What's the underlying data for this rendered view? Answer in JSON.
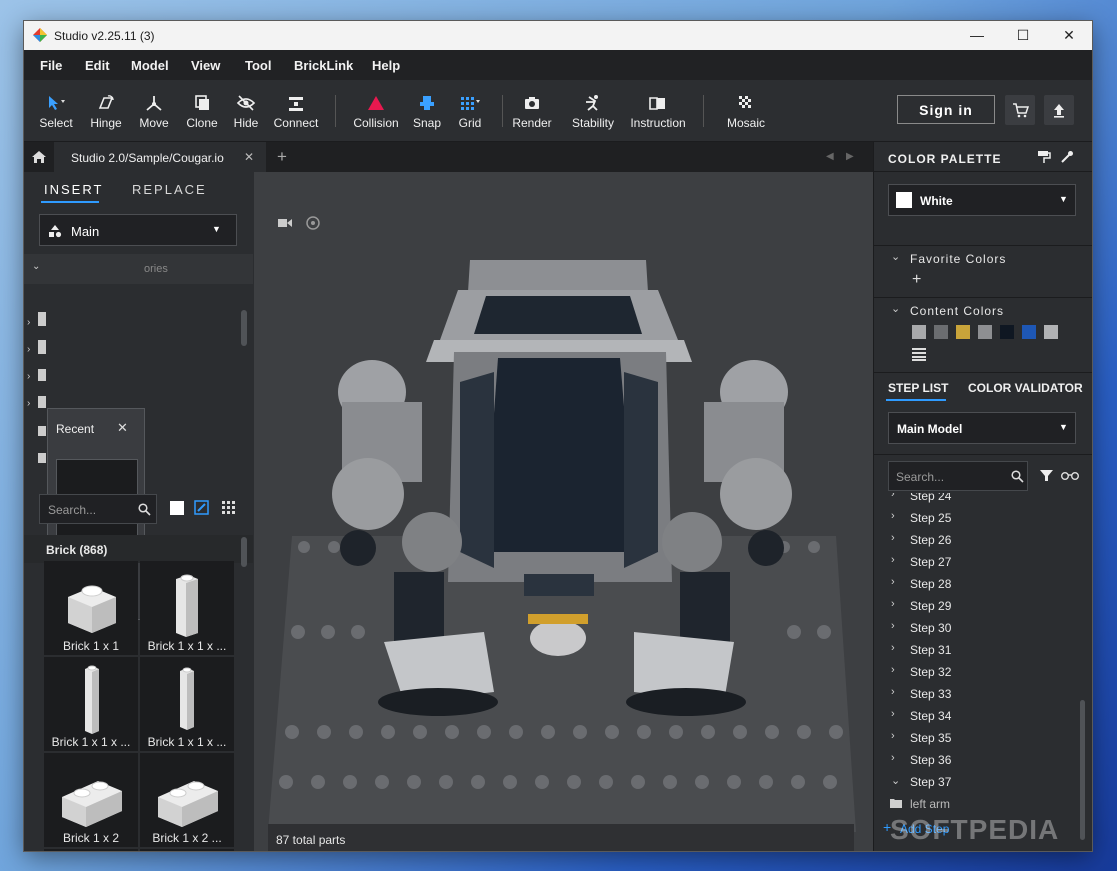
{
  "window": {
    "title": "Studio v2.25.11 (3)",
    "minimize": "—",
    "maximize": "☐",
    "close": "✕"
  },
  "menu": [
    "File",
    "Edit",
    "Model",
    "View",
    "Tool",
    "BrickLink",
    "Help"
  ],
  "toolbar": {
    "tools": [
      "Select",
      "Hinge",
      "Move",
      "Clone",
      "Hide",
      "Connect",
      "Collision",
      "Snap",
      "Grid",
      "Render",
      "Stability",
      "Instruction",
      "Mosaic"
    ],
    "signin": "Sign in"
  },
  "tabs": {
    "file_tab": "Studio 2.0/Sample/Cougar.io",
    "close": "✕",
    "add": "+"
  },
  "left": {
    "tab_insert": "INSERT",
    "tab_replace": "REPLACE",
    "library": "Main",
    "category_hint": "ories",
    "recent_title": "Recent",
    "search_placeholder": "Search...",
    "brick_header": "Brick (868)",
    "bricks": [
      "Brick 1 x 1",
      "Brick 1 x 1 x ...",
      "Brick 1 x 1 x ...",
      "Brick 1 x 1 x ...",
      "Brick 1 x 2",
      "Brick 1 x 2 ..."
    ]
  },
  "viewport": {
    "status": "87 total parts"
  },
  "right": {
    "palette_title": "COLOR PALETTE",
    "color_selected": "White",
    "favorite_colors": "Favorite Colors",
    "content_colors": "Content Colors",
    "swatches": [
      "#a8a9ab",
      "#6b6d70",
      "#c9a43a",
      "#8e8f92",
      "#0f1722",
      "#1e57b5",
      "#b1b2b4"
    ],
    "tab_steplist": "STEP LIST",
    "tab_validator": "COLOR VALIDATOR",
    "model_select": "Main Model",
    "search_placeholder": "Search...",
    "steps": [
      "Step 24",
      "Step 25",
      "Step 26",
      "Step 27",
      "Step 28",
      "Step 29",
      "Step 30",
      "Step 31",
      "Step 32",
      "Step 33",
      "Step 34",
      "Step 35",
      "Step 36",
      "Step 37"
    ],
    "sub_item": "left arm",
    "add_step": "Add Step"
  },
  "watermark": "SOFTPEDIA"
}
